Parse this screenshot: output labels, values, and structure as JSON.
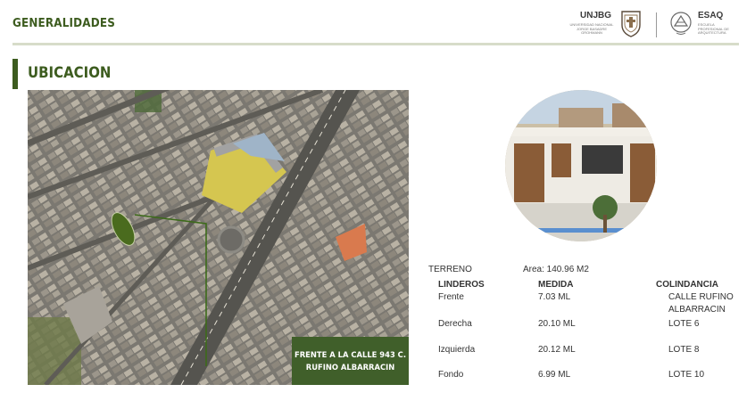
{
  "header": {
    "title": "GENERALIDADES",
    "logo_unjbg": {
      "name": "UNJBG",
      "sub": "UNIVERSIDAD NACIONAL JORGE BASADRE GROHMANN"
    },
    "logo_esaq": {
      "name": "ESAQ",
      "sub": "ESCUELA PROFESIONAL DE ARQUITECTURA"
    }
  },
  "section": {
    "title": "UBICACION"
  },
  "map": {
    "caption_line1": "FRENTE A LA CALLE 943 C.",
    "caption_line2": "RUFINO ALBARRACIN"
  },
  "lot": {
    "terreno_label": "TERRENO",
    "area_label": "Area: 140.96 M2",
    "headers": {
      "linderos": "LINDEROS",
      "medida": "MEDIDA",
      "colindancia": "COLINDANCIA"
    },
    "rows": [
      {
        "lindero": "Frente",
        "medida": "7.03 ML",
        "colindancia": "CALLE RUFINO",
        "colindancia2": "ALBARRACIN"
      },
      {
        "lindero": "Derecha",
        "medida": "20.10 ML",
        "colindancia": "LOTE 6"
      },
      {
        "lindero": "Izquierda",
        "medida": "20.12 ML",
        "colindancia": "LOTE 8"
      },
      {
        "lindero": "Fondo",
        "medida": "6.99 ML",
        "colindancia": "LOTE 10"
      }
    ]
  },
  "colors": {
    "accent": "#3d5c1f",
    "header_line": "#d7dcc9",
    "caption_bg": "#405f2a"
  }
}
